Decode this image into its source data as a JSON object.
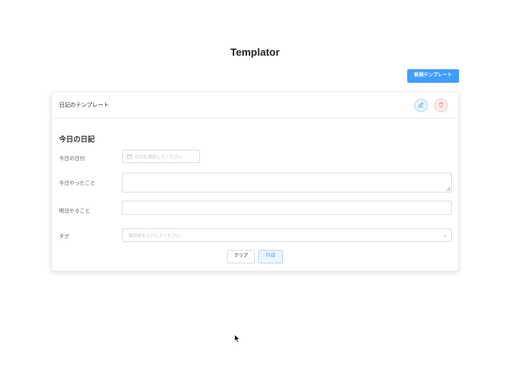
{
  "header": {
    "title": "Templator",
    "new_template_label": "新規テンプレート"
  },
  "card": {
    "title": "日記のテンプレート",
    "form_title": "今日の日記",
    "fields": {
      "today_date": {
        "label": "今日の日付",
        "placeholder": "日付を選択してください",
        "value": ""
      },
      "today_done": {
        "label": "今日やったこと",
        "value": ""
      },
      "tomorrow_todo": {
        "label": "明日やること",
        "value": ""
      },
      "tags": {
        "label": "タグ",
        "placeholder": "選択肢を入力してください"
      }
    },
    "buttons": {
      "clear": "クリア",
      "create": "作成"
    }
  },
  "icons": {
    "edit": "edit-icon",
    "delete": "trash-icon",
    "calendar": "calendar-icon",
    "dropdown": "chevron-down-icon",
    "cursor": "mouse-pointer-icon"
  },
  "colors": {
    "primary": "#409eff",
    "danger": "#f56c6c",
    "border": "#dcdfe6"
  }
}
